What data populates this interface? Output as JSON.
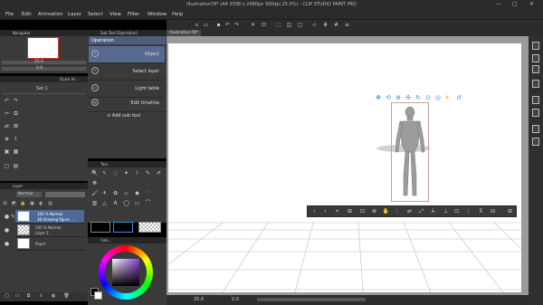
{
  "window": {
    "title": "Illustration78* (A4 3508 x 2480px 300dpi 25.0%) - CLIP STUDIO PAINT PRO",
    "min": "—",
    "max": "□",
    "close": "✕"
  },
  "menu": [
    "File",
    "Edit",
    "Animation",
    "Layer",
    "Select",
    "View",
    "Filter",
    "Window",
    "Help"
  ],
  "navigator": {
    "title": "Navigator",
    "zoom": "25.0",
    "angle": "0.0"
  },
  "quick_access": {
    "title": "Quick Ac...",
    "set": "Set 1"
  },
  "sub_tool": {
    "title": "Sub Tool [Operation]",
    "header": "Operation",
    "items": [
      "Object",
      "Select layer",
      "Light table",
      "Edit timeline"
    ],
    "add": "Add sub tool"
  },
  "tool_panel": {
    "title": "Tool"
  },
  "layer_panel": {
    "title": "Layer",
    "blend": "Normal",
    "rows": [
      {
        "opacity": "100 %  Normal",
        "name": "3D drawing figure ..."
      },
      {
        "opacity": "100 %  Normal",
        "name": "Layer 1"
      },
      {
        "opacity": "",
        "name": "Paper"
      }
    ]
  },
  "color_panel": {
    "title": "Colo..."
  },
  "canvas": {
    "tab": "Illustration78*"
  },
  "status": {
    "zoom": "25.0",
    "angle": "0.0"
  },
  "colors": {
    "accent": "#3a8fd6",
    "fg_color": "#000000",
    "bg_color": "#ffffff"
  }
}
